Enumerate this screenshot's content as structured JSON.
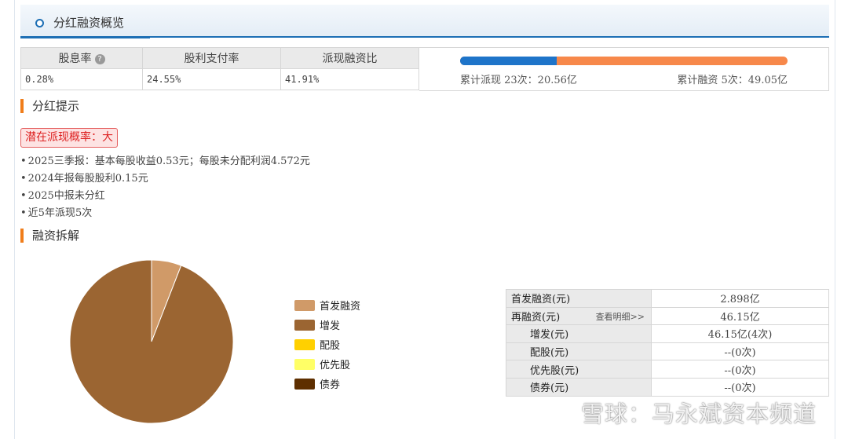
{
  "header": {
    "title": "分红融资概览"
  },
  "summary_table": {
    "headers": [
      "股息率",
      "股利支付率",
      "派现融资比"
    ],
    "values": [
      "0.28%",
      "24.55%",
      "41.91%"
    ],
    "help_icon": "question-icon"
  },
  "ratio": {
    "dividend_label": "累计派现 23次：20.56亿",
    "financing_label": "累计融资 5次：49.05亿",
    "dividend_share": 0.2954,
    "colors": {
      "dividend": "#1e74c9",
      "financing": "#f7884a"
    }
  },
  "dividend_hint": {
    "title": "分红提示",
    "badge": "潜在派现概率：大",
    "tips": [
      "2025三季报：基本每股收益0.53元；每股未分配利润4.572元",
      "2024年报每股股利0.15元",
      "2025中报未分红",
      "近5年派现5次"
    ]
  },
  "financing": {
    "title": "融资拆解",
    "legend": [
      {
        "label": "首发融资",
        "color": "#d09a68"
      },
      {
        "label": "增发",
        "color": "#9b6532"
      },
      {
        "label": "配股",
        "color": "#ffd000"
      },
      {
        "label": "优先股",
        "color": "#ffff66"
      },
      {
        "label": "债券",
        "color": "#5e2f00"
      }
    ],
    "table": [
      {
        "label": "首发融资(元)",
        "value": "2.898亿",
        "indent": 0
      },
      {
        "label": "再融资(元)",
        "value": "46.15亿",
        "indent": 0,
        "link": "查看明细>>"
      },
      {
        "label": "增发(元)",
        "value": "46.15亿(4次)",
        "indent": 1
      },
      {
        "label": "配股(元)",
        "value": "--(0次)",
        "indent": 1
      },
      {
        "label": "优先股(元)",
        "value": "--(0次)",
        "indent": 1
      },
      {
        "label": "债券(元)",
        "value": "--(0次)",
        "indent": 1
      }
    ]
  },
  "chart_data": {
    "type": "pie",
    "labels": [
      "首发融资",
      "增发"
    ],
    "values": [
      2.898,
      46.15
    ],
    "colors": [
      "#d09a68",
      "#9b6532"
    ]
  },
  "watermark": {
    "text": "雪球：马永斌资本频道"
  }
}
